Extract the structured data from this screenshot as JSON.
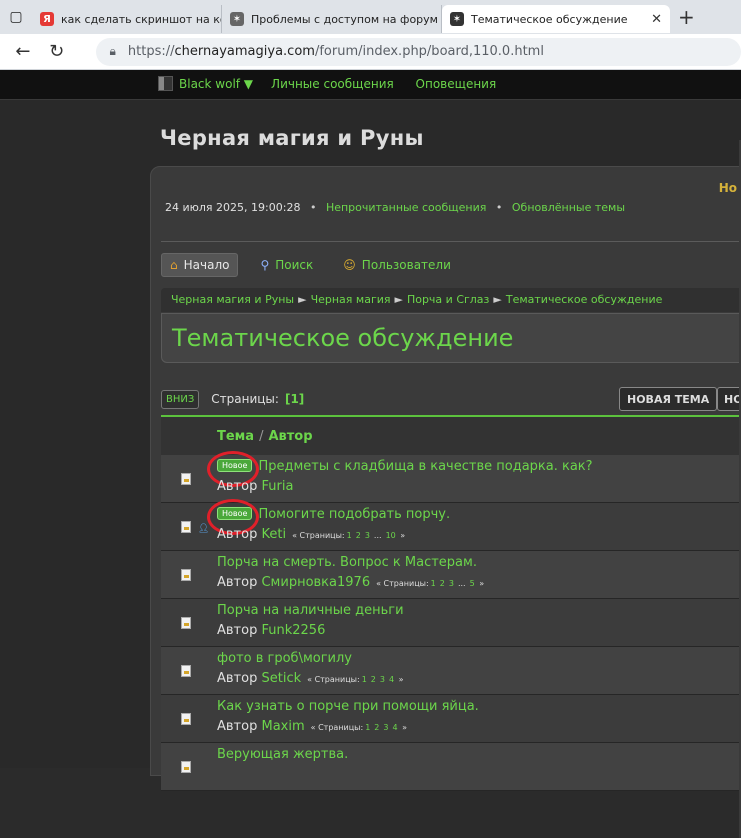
{
  "browser": {
    "tabs": [
      {
        "title": "как сделать скриншот на компь",
        "icon": "yandex-icon"
      },
      {
        "title": "Проблемы с доступом на форум",
        "icon": "forum-logo-icon"
      },
      {
        "title": "Тематическое обсуждение",
        "icon": "forum-logo-icon",
        "active": true
      }
    ],
    "url_prefix": "https://",
    "url_host": "chernayamagiya.com",
    "url_path": "/forum/index.php/board,110.0.html"
  },
  "forum": {
    "username": "Black wolf ▼",
    "top_links": [
      "Личные сообщения",
      "Оповещения"
    ],
    "site_title": "Черная магия и Руны",
    "new_partial": "Но",
    "date": "24 июля 2025, 19:00:28",
    "date_links": [
      "Непрочитанные сообщения",
      "Обновлённые темы"
    ],
    "menu": [
      {
        "label": "Начало",
        "icon": "house-icon"
      },
      {
        "label": "Поиск",
        "icon": "magnifier-icon"
      },
      {
        "label": "Пользователи",
        "icon": "users-icon"
      }
    ],
    "breadcrumbs": [
      "Черная магия и Руны",
      "Черная магия",
      "Порча и Сглаз",
      "Тематическое обсуждение"
    ],
    "board_title": "Тематическое обсуждение",
    "down_button": "ВНИЗ",
    "pages_label": "Страницы:",
    "pages_current": "[1]",
    "new_topic_button": "НОВАЯ ТЕМА",
    "second_button_partial": "НО",
    "header_topic": "Тема",
    "header_sep": "/",
    "header_author": "Автор",
    "author_prefix": "Автор",
    "pages_small_label": "Страницы:",
    "new_badge": "Новое",
    "topics": [
      {
        "subject": "Предметы с кладбища в качестве подарка. как?",
        "author": "Furia",
        "isNew": true,
        "pages": []
      },
      {
        "subject": "Помогите подобрать порчу.",
        "author": "Keti",
        "isNew": true,
        "pages": [
          "1",
          "2",
          "3",
          "...",
          "10"
        ]
      },
      {
        "subject": "Порча на смерть. Вопрос к Мастерам.",
        "author": "Смирновка1976",
        "isNew": false,
        "pages": [
          "1",
          "2",
          "3",
          "...",
          "5"
        ]
      },
      {
        "subject": "Порча на наличные деньги",
        "author": "Funk2256",
        "isNew": false,
        "pages": []
      },
      {
        "subject": "фото в гроб\\могилу",
        "author": "Setick",
        "isNew": false,
        "pages": [
          "1",
          "2",
          "3",
          "4"
        ]
      },
      {
        "subject": "Как узнать о порче при помощи яйца.",
        "author": "Maxim",
        "isNew": false,
        "pages": [
          "1",
          "2",
          "3",
          "4"
        ]
      },
      {
        "subject": "Верующая жертва.",
        "author": "",
        "isNew": false,
        "pages": []
      }
    ]
  }
}
